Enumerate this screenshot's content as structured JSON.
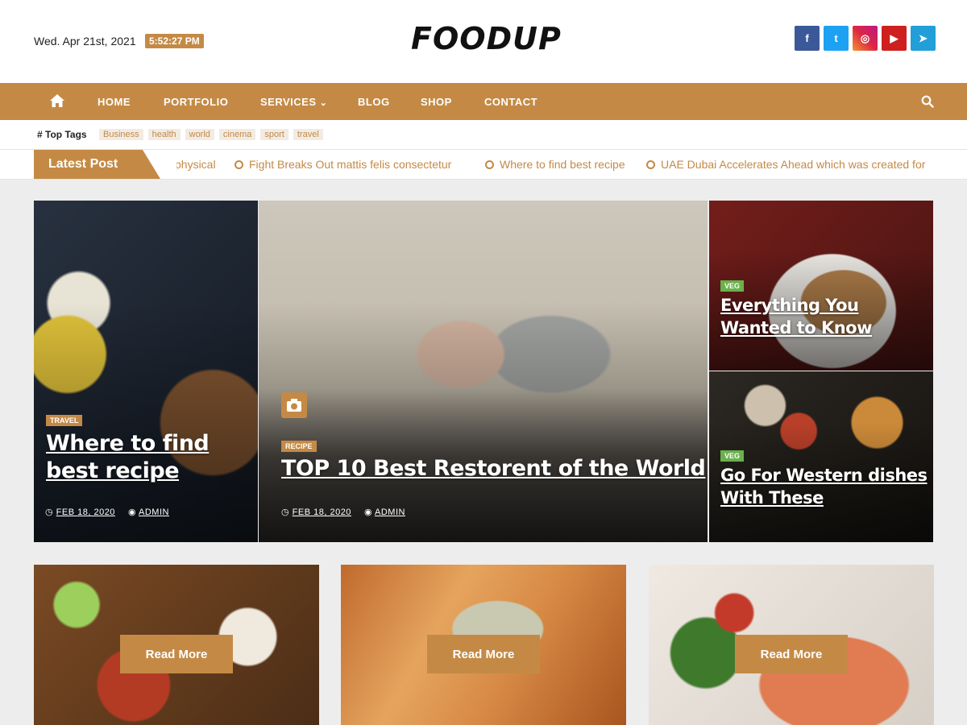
{
  "header": {
    "date": "Wed. Apr 21st, 2021",
    "time": "5:52:27 PM",
    "logo": "FOODUP",
    "socials": [
      {
        "icon": "facebook-icon",
        "glyph": "f",
        "color": "#3b5998"
      },
      {
        "icon": "twitter-icon",
        "glyph": "t",
        "color": "#1da1f2"
      },
      {
        "icon": "instagram-icon",
        "glyph": "◎",
        "color": "#d6249f"
      },
      {
        "icon": "youtube-icon",
        "glyph": "▶",
        "color": "#cd201f"
      },
      {
        "icon": "telegram-icon",
        "glyph": "➤",
        "color": "#229ed9"
      }
    ]
  },
  "nav": {
    "items": [
      "HOME",
      "PORTFOLIO",
      "SERVICES",
      "BLOG",
      "SHOP",
      "CONTACT"
    ],
    "services_caret": "⌄"
  },
  "tags": {
    "title": "Top Tags",
    "items": [
      "Business",
      "health",
      "world",
      "cinema",
      "sport",
      "travel"
    ]
  },
  "ticker": {
    "label": "Latest Post",
    "items": [
      "physical",
      "Fight Breaks Out mattis felis consectetur",
      "Where to find best recipe",
      "UAE Dubai Accelerates Ahead which was created for"
    ]
  },
  "hero": {
    "left": {
      "category": "TRAVEL",
      "title_line1": "Where to find",
      "title_line2": "best recipe",
      "date": "FEB 18, 2020",
      "author": "ADMIN"
    },
    "center": {
      "category": "RECIPE",
      "title": "TOP 10 Best Restorent of the World",
      "date": "FEB 18, 2020",
      "author": "ADMIN"
    },
    "right_top": {
      "category": "VEG",
      "title_line1": "Everything You",
      "title_line2": "Wanted to Know"
    },
    "right_bottom": {
      "category": "VEG",
      "title_line1": "Go For Western dishes",
      "title_line2": "With These"
    }
  },
  "cards": {
    "read_more": "Read More"
  },
  "colors": {
    "accent": "#c48a45",
    "veg_badge": "#6ab04c"
  }
}
